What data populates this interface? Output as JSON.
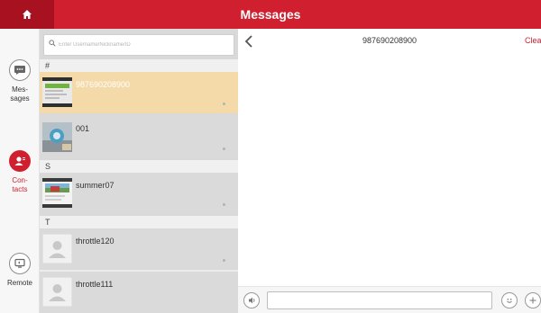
{
  "header": {
    "title": "Messages"
  },
  "nav": [
    {
      "label": "Mes-\nsages"
    },
    {
      "label": "Con-\ntacts"
    },
    {
      "label": "Remote"
    }
  ],
  "search": {
    "placeholder": "Enter Username/Nickname/ID"
  },
  "sections": [
    "#",
    "S",
    "T"
  ],
  "contacts": [
    {
      "name": "987690208900",
      "selected": true
    },
    {
      "name": "001",
      "selected": false
    },
    {
      "name": "summer07",
      "selected": false
    },
    {
      "name": "throttle120",
      "selected": false
    },
    {
      "name": "throttle111",
      "selected": false
    }
  ],
  "chat": {
    "peer": "987690208900",
    "clear_label": "Clear"
  },
  "colors": {
    "accent": "#d0202f",
    "selected_row": "#f4d9a9"
  }
}
